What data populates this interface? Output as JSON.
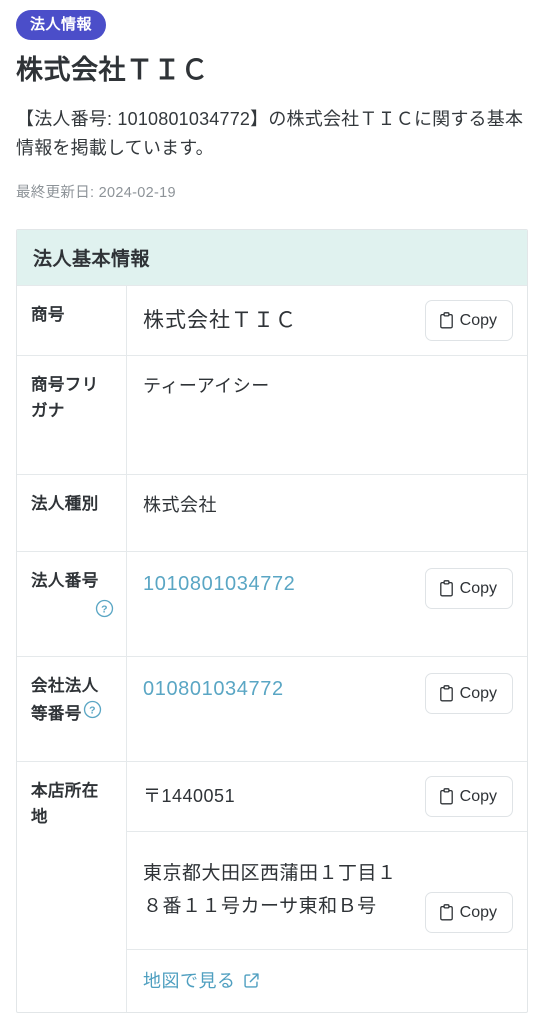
{
  "header": {
    "badge_label": "法人情報",
    "title": "株式会社ＴＩＣ",
    "lede": "【法人番号: 1010801034772】の株式会社ＴＩＣに関する基本情報を掲載しています。",
    "updated_label": "最終更新日: 2024-02-19"
  },
  "table": {
    "caption": "法人基本情報",
    "copy_label": "Copy",
    "rows": [
      {
        "label": "商号",
        "value": "株式会社ＴＩＣ",
        "has_copy": true,
        "has_help": false,
        "is_link": false
      },
      {
        "label": "商号フリガナ",
        "value": "ティーアイシー",
        "has_copy": false,
        "has_help": false,
        "is_link": false
      },
      {
        "label": "法人種別",
        "value": "株式会社",
        "has_copy": false,
        "has_help": false,
        "is_link": false
      },
      {
        "label": "法人番号",
        "value": "1010801034772",
        "has_copy": true,
        "has_help": true,
        "is_link": true
      },
      {
        "label": "会社法人等番号",
        "value": "010801034772",
        "has_copy": true,
        "has_help": true,
        "is_link": true
      }
    ],
    "address_row": {
      "label": "本店所在地",
      "postal_code": "〒1440051",
      "street": "東京都大田区西蒲田１丁目１８番１１号カーサ東和Ｂ号",
      "map_link_label": "地図で見る"
    }
  },
  "icons": {
    "copy": "clipboard-icon",
    "help": "help-circle-icon",
    "external": "external-link-icon"
  },
  "colors": {
    "badge_bg": "#4b4ec9",
    "caption_bg": "#e0f2ef",
    "link": "#5aa6c4",
    "help": "#5aa6c4",
    "border": "#e5e9eb",
    "muted_text": "#8d9398"
  }
}
